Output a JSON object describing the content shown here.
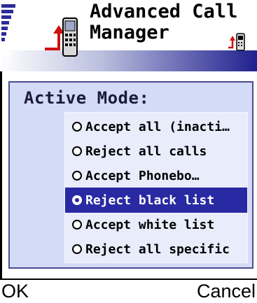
{
  "app": {
    "title_line1": "Advanced Call",
    "title_line2": "Manager"
  },
  "dialog": {
    "title": "Active Mode:",
    "options": [
      {
        "label": "Accept all (inacti…",
        "selected": false
      },
      {
        "label": "Reject all calls",
        "selected": false
      },
      {
        "label": "Accept Phonebo…",
        "selected": false
      },
      {
        "label": "Reject black list",
        "selected": true
      },
      {
        "label": "Accept white list",
        "selected": false
      },
      {
        "label": "Reject all specific",
        "selected": false
      }
    ]
  },
  "softkeys": {
    "left": "OK",
    "right": "Cancel"
  },
  "colors": {
    "selection": "#2929a3",
    "dialog_bg": "#d4dbf7",
    "header_gradient_end": "#20208e"
  },
  "icons": {
    "status": "signal-strength-icon",
    "app": "call-manager-phone-icon",
    "title_small": "call-manager-small-icon",
    "antenna": "antenna-icon"
  }
}
